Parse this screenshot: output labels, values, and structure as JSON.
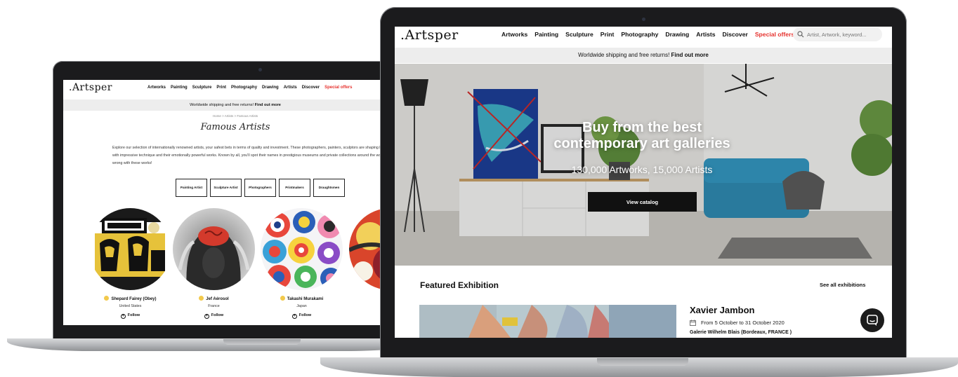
{
  "small_site": {
    "logo": ".Artsper",
    "nav": [
      "Artworks",
      "Painting",
      "Sculpture",
      "Print",
      "Photography",
      "Drawing",
      "Artists",
      "Discover"
    ],
    "nav_special": "Special offers",
    "banner_text": "Worldwide shipping and free returns!",
    "banner_link": "Find out more",
    "breadcrumb": "Home > Artists > Famous Artists",
    "title": "Famous Artists",
    "description": "Explore our selection of internationally renowned artists, your safest bets in terms of quality and investment. These photographers, painters, sculptors are shaping history of art with impressive technique and their emotionally powerful works. Known by all, you'll spot their names in prestigious museums and private collections around the world. You can't go wrong with these works!",
    "categories": [
      "Painting Artist",
      "Sculpture Artist",
      "Photographers",
      "Printmakers",
      "Draughtsmen"
    ],
    "artists": [
      {
        "name": "Shepard Fairey (Obey)",
        "country": "United States"
      },
      {
        "name": "Jef Aérosol",
        "country": "France"
      },
      {
        "name": "Takashi Murakami",
        "country": "Japan"
      }
    ],
    "follow_label": "Follow"
  },
  "big_site": {
    "logo": ".Artsper",
    "nav": [
      "Artworks",
      "Painting",
      "Sculpture",
      "Print",
      "Photography",
      "Drawing",
      "Artists",
      "Discover"
    ],
    "nav_special": "Special offers",
    "search_placeholder": "Artist, Artwork, keyword...",
    "banner_text": "Worldwide shipping and free returns!",
    "banner_link": "Find out more",
    "hero_title": "Buy from the best contemporary art galleries",
    "hero_subtitle": "130,000 Artworks, 15,000 Artists",
    "hero_button": "View catalog",
    "featured_heading": "Featured Exhibition",
    "see_all": "See all exhibitions",
    "exhibition_name": "Xavier Jambon",
    "exhibition_dates": "From 5 October to 31 October 2020",
    "exhibition_gallery": "Galerie Wilhelm Blais (Bordeaux, FRANCE )"
  },
  "colors": {
    "accent_red": "#e6322e",
    "laptop_bezel": "#1b1b1d",
    "banner_bg": "#ededed"
  },
  "icons": [
    "search-icon",
    "calendar-icon",
    "chat-icon",
    "follow-plus-icon"
  ]
}
